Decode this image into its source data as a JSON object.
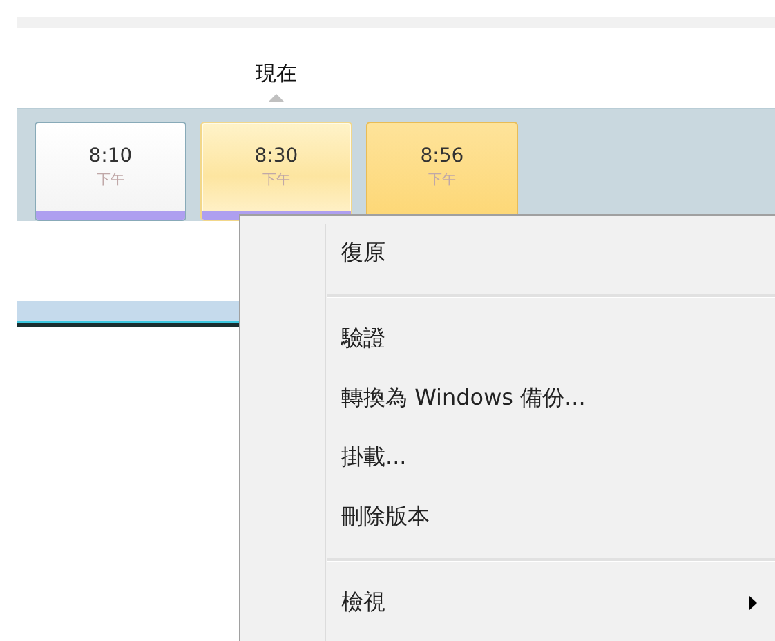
{
  "now_label": "現在",
  "snapshots": [
    {
      "time": "8:10",
      "period": "下午",
      "selected": false,
      "hovered": false,
      "marked": true
    },
    {
      "time": "8:30",
      "period": "下午",
      "selected": true,
      "hovered": false,
      "marked": true
    },
    {
      "time": "8:56",
      "period": "下午",
      "selected": false,
      "hovered": true,
      "marked": false
    }
  ],
  "context_menu": {
    "groups": [
      [
        {
          "label": "復原",
          "submenu": false
        }
      ],
      [
        {
          "label": "驗證",
          "submenu": false
        },
        {
          "label": "轉換為 Windows 備份...",
          "submenu": false
        },
        {
          "label": "掛載...",
          "submenu": false
        },
        {
          "label": "刪除版本",
          "submenu": false
        }
      ],
      [
        {
          "label": "檢視",
          "submenu": true
        }
      ]
    ]
  }
}
